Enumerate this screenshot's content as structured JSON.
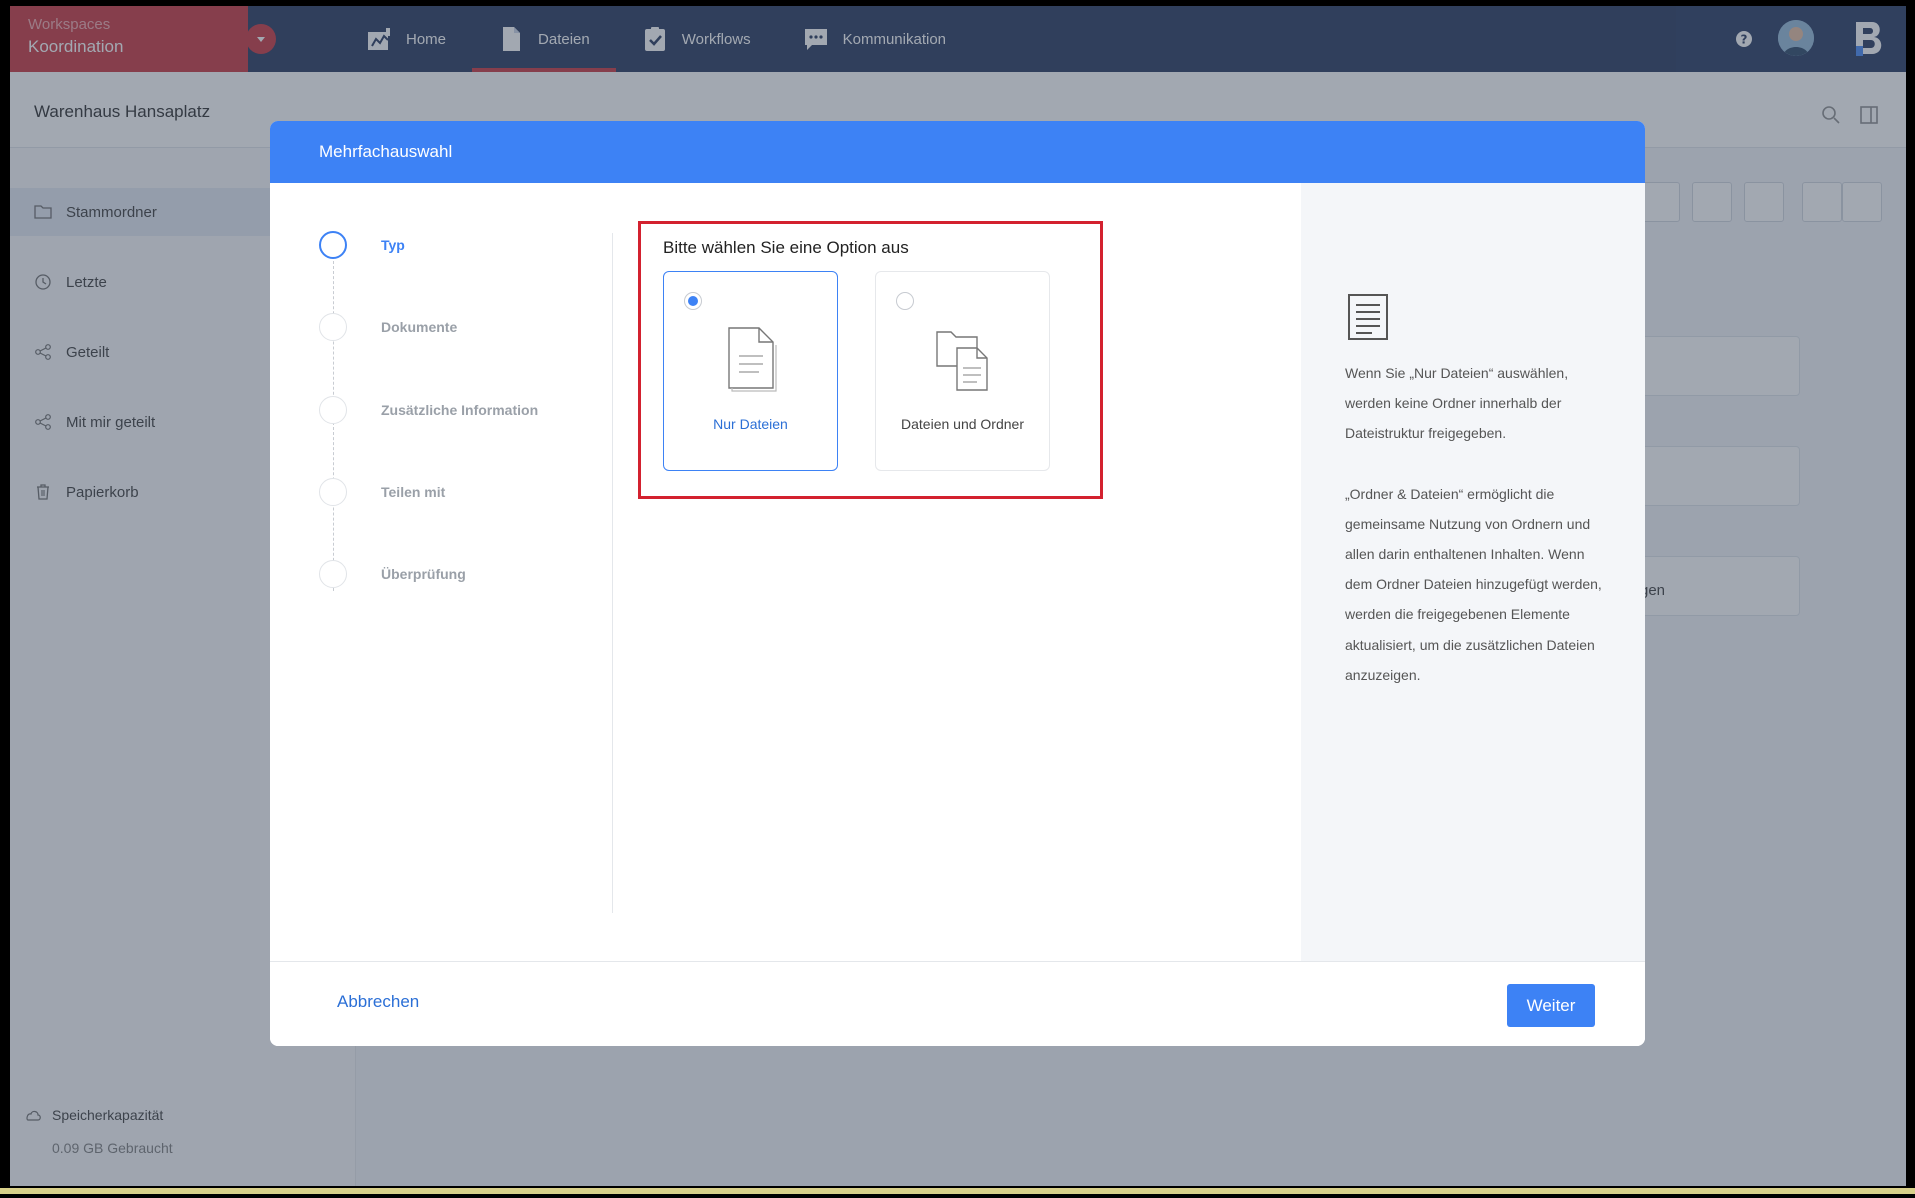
{
  "topbar": {
    "workspace_caption": "Workspaces",
    "workspace_name": "Koordination",
    "nav": [
      {
        "label": "Home",
        "icon": "home-icon",
        "active": false
      },
      {
        "label": "Dateien",
        "icon": "file-icon",
        "active": true
      },
      {
        "label": "Workflows",
        "icon": "clipboard-check-icon",
        "active": false
      },
      {
        "label": "Kommunikation",
        "icon": "chat-icon",
        "active": false
      }
    ],
    "accent_color": "#c62a34",
    "background_color": "#1a2d55"
  },
  "subheader": {
    "project_title": "Warenhaus Hansaplatz"
  },
  "sidebar": {
    "items": [
      {
        "label": "Stammordner",
        "icon": "folder-icon"
      },
      {
        "label": "Letzte",
        "icon": "clock-icon"
      },
      {
        "label": "Geteilt",
        "icon": "share-icon"
      },
      {
        "label": "Mit mir geteilt",
        "icon": "share-icon"
      },
      {
        "label": "Papierkorb",
        "icon": "trash-icon"
      }
    ],
    "storage_label": "Speicherkapazität",
    "storage_used": "0.09 GB Gebraucht"
  },
  "background": {
    "card_text_partial": "gen"
  },
  "modal": {
    "title": "Mehrfachauswahl",
    "header_color": "#3d82f5",
    "steps": [
      {
        "label": "Typ",
        "active": true
      },
      {
        "label": "Dokumente",
        "active": false
      },
      {
        "label": "Zusätzliche Information",
        "active": false
      },
      {
        "label": "Teilen mit",
        "active": false
      },
      {
        "label": "Überprüfung",
        "active": false
      }
    ],
    "options_title": "Bitte wählen Sie eine Option aus",
    "options": [
      {
        "label": "Nur Dateien",
        "selected": true,
        "icon": "file-icon"
      },
      {
        "label": "Dateien und Ordner",
        "selected": false,
        "icon": "folder-file-icon"
      }
    ],
    "info": {
      "paragraph_1": "Wenn Sie „Nur Dateien“ auswählen, werden keine Ordner innerhalb der Dateistruktur freigegeben.",
      "paragraph_2": "„Ordner & Dateien“ ermöglicht die gemeinsame Nutzung von Ordnern und allen darin enthaltenen Inhalten. Wenn dem Ordner Dateien hinzugefügt werden, werden die freigegebenen Elemente aktualisiert, um die zusätzlichen Dateien anzuzeigen."
    },
    "cancel_label": "Abbrechen",
    "next_label": "Weiter"
  }
}
